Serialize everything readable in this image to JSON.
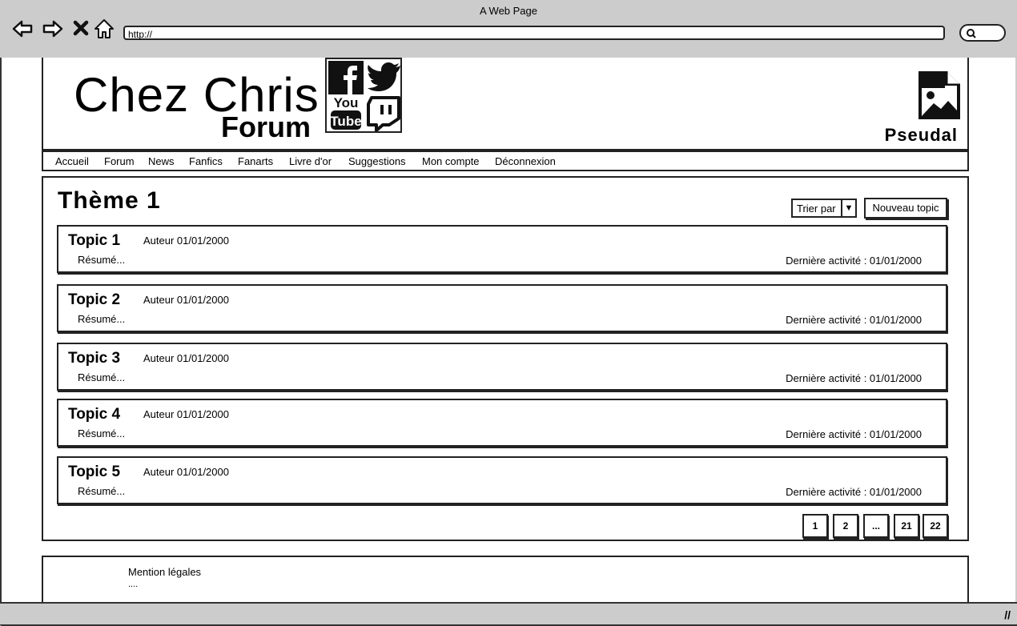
{
  "browser": {
    "window_title": "A Web Page",
    "url": "http://"
  },
  "header": {
    "site_title": "Chez Chris",
    "site_subtitle": "Forum",
    "social_icons": [
      "facebook-icon",
      "twitter-icon",
      "youtube-icon",
      "twitch-icon"
    ],
    "youtube_text_top": "You",
    "youtube_text_bottom": "Tube",
    "username": "Pseudal"
  },
  "nav": {
    "items": [
      "Accueil",
      "Forum",
      "News",
      "Fanfics",
      "Fanarts",
      "Livre d'or",
      "Suggestions",
      "Mon compte",
      "Déconnexion"
    ]
  },
  "main": {
    "title": "Thème 1",
    "sort_label": "Trier par",
    "new_topic_label": "Nouveau topic",
    "topics": [
      {
        "title": "Topic 1",
        "author": "Auteur 01/01/2000",
        "summary": "Résumé...",
        "activity": "Dernière activité : 01/01/2000"
      },
      {
        "title": "Topic 2",
        "author": "Auteur 01/01/2000",
        "summary": "Résumé...",
        "activity": "Dernière activité : 01/01/2000"
      },
      {
        "title": "Topic 3",
        "author": "Auteur 01/01/2000",
        "summary": "Résumé...",
        "activity": "Dernière activité : 01/01/2000"
      },
      {
        "title": "Topic 4",
        "author": "Auteur 01/01/2000",
        "summary": "Résumé...",
        "activity": "Dernière activité : 01/01/2000"
      },
      {
        "title": "Topic 5",
        "author": "Auteur 01/01/2000",
        "summary": "Résumé...",
        "activity": "Dernière activité : 01/01/2000"
      }
    ],
    "pagination": [
      "1",
      "2",
      "...",
      "21",
      "22"
    ]
  },
  "footer": {
    "legal": "Mention légales",
    "dots": "...."
  }
}
